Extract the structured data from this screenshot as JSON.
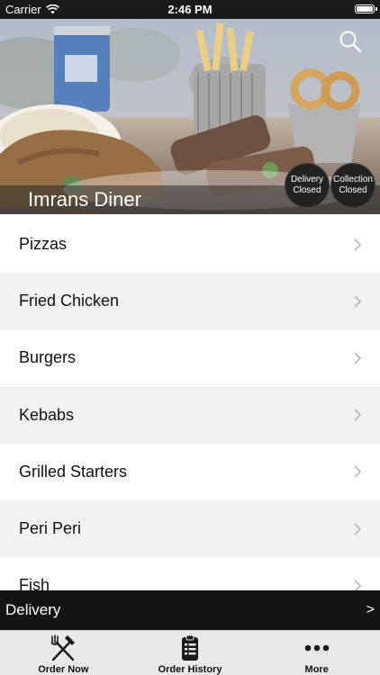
{
  "status_bar": {
    "carrier": "Carrier",
    "time": "2:46 PM",
    "battery_level": 1.0
  },
  "header": {
    "restaurant_name": "Imrans Diner",
    "search_icon": "search-icon",
    "delivery_badge": {
      "line1": "Delivery",
      "line2": "Closed"
    },
    "collection_badge": {
      "line1": "Collection",
      "line2": "Closed"
    }
  },
  "menu": {
    "categories": [
      {
        "label": "Pizzas"
      },
      {
        "label": "Fried Chicken"
      },
      {
        "label": "Burgers"
      },
      {
        "label": "Kebabs"
      },
      {
        "label": "Grilled Starters"
      },
      {
        "label": "Peri Peri"
      },
      {
        "label": "Fish"
      }
    ],
    "chevron_icon": "chevron-right-icon"
  },
  "delivery_bar": {
    "label": "Delivery",
    "arrow": ">"
  },
  "tab_bar": {
    "tabs": [
      {
        "label": "Order Now",
        "icon": "fork-knife-icon"
      },
      {
        "label": "Order History",
        "icon": "clipboard-list-icon"
      },
      {
        "label": "More",
        "icon": "more-dots-icon"
      }
    ]
  },
  "colors": {
    "status_bar_bg": "#1a1a1a",
    "row_alt_bg": "#f1f2f4",
    "delivery_bar_bg": "#141414",
    "tab_bar_bg": "#e9e9e9",
    "badge_bg": "#222222"
  }
}
